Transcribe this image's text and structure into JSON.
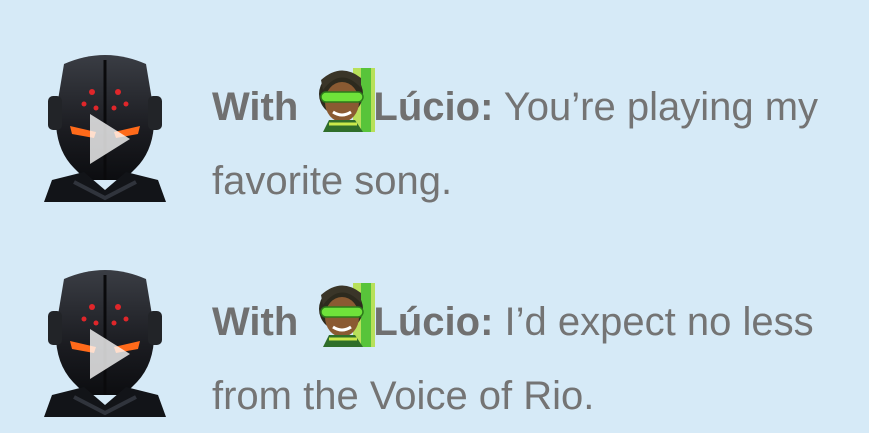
{
  "voice_lines": [
    {
      "prefix": "With",
      "hero": "Lúcio:",
      "text": "You’re playing my favorite song.",
      "speaker_icon": "play-video-thumbnail",
      "hero_icon": "lucio-portrait"
    },
    {
      "prefix": "With",
      "hero": "Lúcio:",
      "text": "I’d expect no less from the Voice of Rio.",
      "speaker_icon": "play-video-thumbnail",
      "hero_icon": "lucio-portrait"
    }
  ],
  "colors": {
    "background": "#d6eaf7",
    "text": "#747474",
    "visor_glow": "#ff6a1a",
    "lucio_visor": "#6fe23a"
  }
}
